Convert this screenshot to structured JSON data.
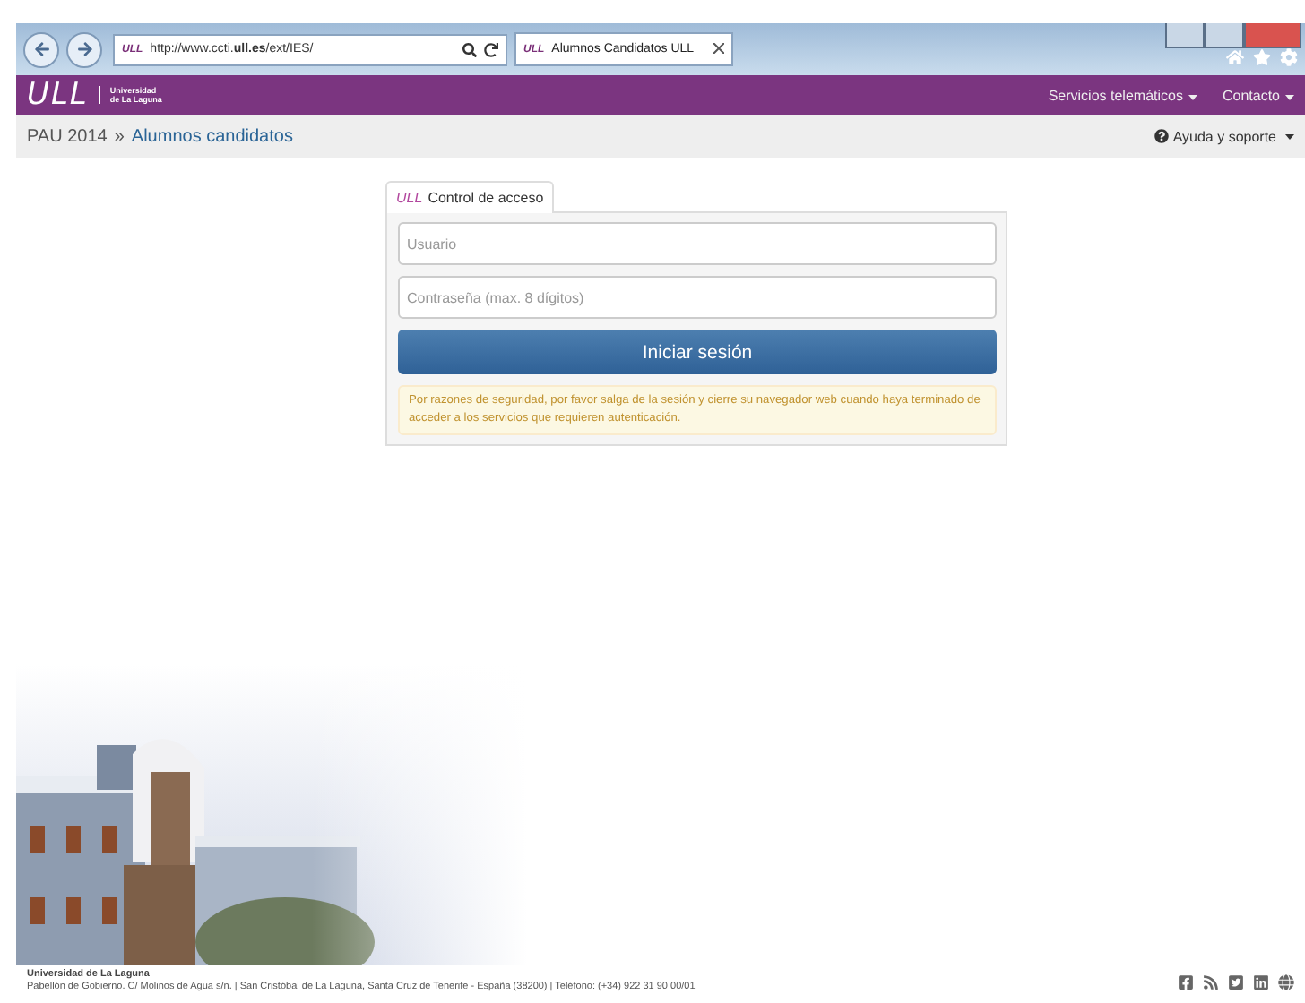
{
  "browser": {
    "address": "http://www.ccti.**ull.es**/ext/IES/",
    "tab": {
      "favicon": "ULL",
      "title": "Alumnos Candidatos ULL",
      "selected": true
    },
    "address_favicon": "ULL"
  },
  "header": {
    "logo": "ULL",
    "logo_text": [
      "Universidad",
      "de La Laguna"
    ],
    "menu": [
      {
        "label": "Servicios telemáticos"
      },
      {
        "label": "Contacto"
      }
    ]
  },
  "breadcrumb": {
    "items": [
      "PAU 2014",
      "Alumnos candidatos"
    ],
    "separator": "»",
    "help": "Ayuda y soporte"
  },
  "login": {
    "tab": {
      "logo": "ULL",
      "label": "Control de acceso"
    },
    "user": {
      "placeholder": "Usuario"
    },
    "password": {
      "placeholder": "Contraseña (max. 8 dígitos)"
    },
    "button": "Iniciar sesión",
    "notice": "Por razones de seguridad, por favor salga de la sesión y cierre su navegador web cuando haya terminado de acceder a los servicios que requieren autenticación."
  },
  "footer": {
    "title": "Universidad de La Laguna",
    "address": "Pabellón de Gobierno. C/ Molinos de Agua s/n. | San Cristóbal de La Laguna, Santa Cruz de Tenerife - España (38200) | Teléfono: (+34) 922 31 90 00/01"
  }
}
